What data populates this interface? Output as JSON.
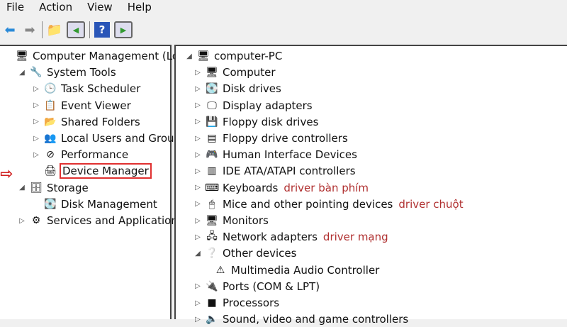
{
  "menu": [
    "File",
    "Action",
    "View",
    "Help"
  ],
  "toolbar": [
    "back",
    "forward",
    "up-folder",
    "show-hide-console-tree",
    "help",
    "show-hide-action-pane"
  ],
  "left_tree": [
    {
      "label": "Computer Management (Local",
      "level": 0,
      "arrow": "",
      "icon": "computer-management-icon"
    },
    {
      "label": "System Tools",
      "level": 1,
      "arrow": "◢",
      "icon": "tools-icon"
    },
    {
      "label": "Task Scheduler",
      "level": 2,
      "arrow": "▷",
      "icon": "clock-icon"
    },
    {
      "label": "Event Viewer",
      "level": 2,
      "arrow": "▷",
      "icon": "event-viewer-icon"
    },
    {
      "label": "Shared Folders",
      "level": 2,
      "arrow": "▷",
      "icon": "shared-folder-icon"
    },
    {
      "label": "Local Users and Groups",
      "level": 2,
      "arrow": "▷",
      "icon": "users-icon"
    },
    {
      "label": "Performance",
      "level": 2,
      "arrow": "▷",
      "icon": "performance-icon"
    },
    {
      "label": "Device Manager",
      "level": 2,
      "arrow": "",
      "icon": "device-manager-icon",
      "selected": true
    },
    {
      "label": "Storage",
      "level": 1,
      "arrow": "◢",
      "icon": "storage-icon"
    },
    {
      "label": "Disk Management",
      "level": 2,
      "arrow": "",
      "icon": "disk-icon"
    },
    {
      "label": "Services and Applications",
      "level": 1,
      "arrow": "▷",
      "icon": "services-icon"
    }
  ],
  "right_tree": [
    {
      "label": "computer-PC",
      "level": 0,
      "arrow": "◢",
      "icon": "computer-icon"
    },
    {
      "label": "Computer",
      "level": 1,
      "arrow": "▷",
      "icon": "monitor-icon"
    },
    {
      "label": "Disk drives",
      "level": 1,
      "arrow": "▷",
      "icon": "disk-icon"
    },
    {
      "label": "Display adapters",
      "level": 1,
      "arrow": "▷",
      "icon": "display-icon"
    },
    {
      "label": "Floppy disk drives",
      "level": 1,
      "arrow": "▷",
      "icon": "floppy-icon"
    },
    {
      "label": "Floppy drive controllers",
      "level": 1,
      "arrow": "▷",
      "icon": "controller-icon"
    },
    {
      "label": "Human Interface Devices",
      "level": 1,
      "arrow": "▷",
      "icon": "hid-icon"
    },
    {
      "label": "IDE ATA/ATAPI controllers",
      "level": 1,
      "arrow": "▷",
      "icon": "ide-icon"
    },
    {
      "label": "Keyboards",
      "level": 1,
      "arrow": "▷",
      "icon": "keyboard-icon",
      "note": "driver bàn phím"
    },
    {
      "label": "Mice and other pointing devices",
      "level": 1,
      "arrow": "▷",
      "icon": "mouse-icon",
      "note": "driver chuột"
    },
    {
      "label": "Monitors",
      "level": 1,
      "arrow": "▷",
      "icon": "monitor-icon"
    },
    {
      "label": "Network adapters",
      "level": 1,
      "arrow": "▷",
      "icon": "network-icon",
      "note": "driver mạng"
    },
    {
      "label": "Other devices",
      "level": 1,
      "arrow": "◢",
      "icon": "other-devices-icon"
    },
    {
      "label": "Multimedia Audio Controller",
      "level": 2,
      "arrow": "",
      "icon": "warning-device-icon"
    },
    {
      "label": "Ports (COM & LPT)",
      "level": 1,
      "arrow": "▷",
      "icon": "port-icon"
    },
    {
      "label": "Processors",
      "level": 1,
      "arrow": "▷",
      "icon": "processor-icon"
    },
    {
      "label": "Sound, video and game controllers",
      "level": 1,
      "arrow": "▷",
      "icon": "sound-icon"
    }
  ]
}
